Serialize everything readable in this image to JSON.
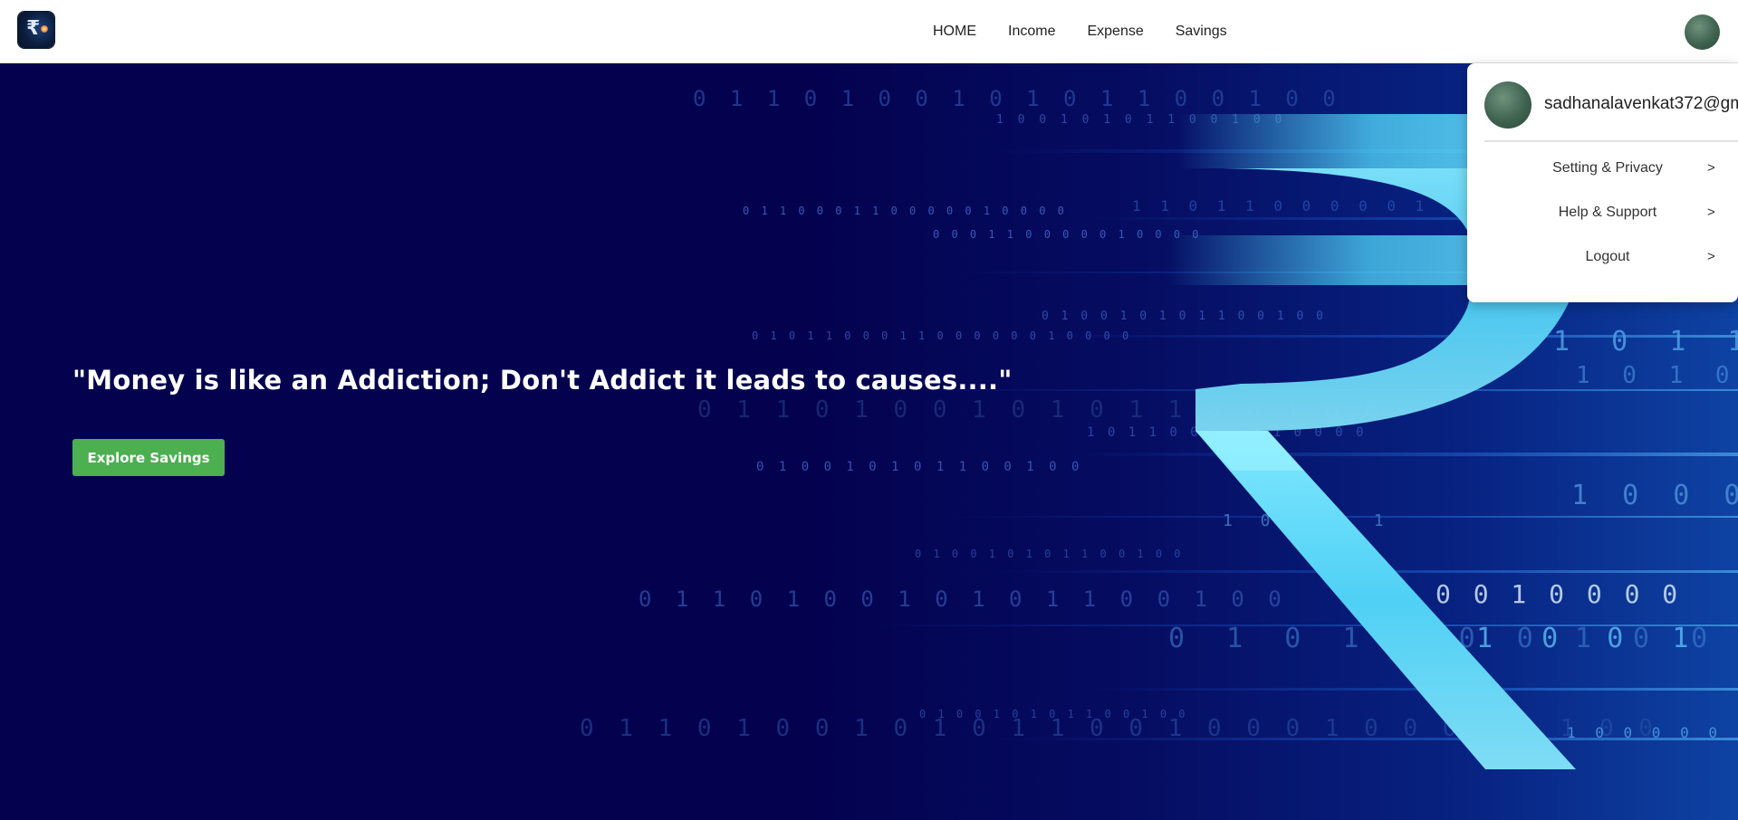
{
  "navbar": {
    "logo_icon": "rupee-logo-icon",
    "links": [
      {
        "label": "HOME"
      },
      {
        "label": "Income"
      },
      {
        "label": "Expense"
      },
      {
        "label": "Savings"
      }
    ],
    "avatar_icon": "user-avatar"
  },
  "hero": {
    "quote": "\"Money is like an Addiction; Don't Addict it leads to causes....\"",
    "cta_label": "Explore Savings",
    "cta_color": "#4caf50",
    "background_color": "#04024f",
    "binary_rows": [
      "0 1 1 0 1 0 0 1 0 1 0 1 1 0 0 1 0 0",
      "1 0 0 1 0 1 0 1 1 0 0 1 0 0",
      "0 1 1 0 0 0 1 1 0 0 0 0 0 1 0 0 0 0",
      "0 0 0 1 1 0 0 0 0 0 1 0 0 0 0",
      "1 1 0 1 1 0 0 0 0 0 1",
      "0 1 0 1 1 0 0 0 1 1 0 0 0 0 0 0 1 0 0 0 0",
      "0 1 0 0 1 0 1 0 1 1 0 0 1 0 0",
      "1 0 1 1 0 0 0 0 0 1 0 0 0 0",
      "0 1 1 0 1 0 0 1 0 1 0 1 1 0 0 1 0 0",
      "1 0 1 1",
      "1 0 1 0 0",
      "0 1 0 0 1 0 1 0 1 1 0 0 1 0 0",
      "1 0 0 0 0 0",
      "1 0 1 0 1",
      "0 1 0 0 1 0 1 0 1 1 0 0 1 0 0",
      "0 1 1 0 1 0 0 1 0 1 0 1 1 0 0 1 0 0",
      "0 0 1 0 0 0 0",
      "0 1 0 1 1 0 0 1 0 0",
      "1 0 0 1 0 0",
      "0 1 0 0 1 0 1 0 1 1 0 0 1 0 0",
      "0 1 1 0 1 0 0 1 0 1 0 1 1 0 0 1 0 0 0 1 0 0 0 0 0 1 0 0",
      "1 0 0 0 0 0"
    ]
  },
  "dropdown": {
    "email": "sadhanalavenkat372@gm",
    "items": [
      {
        "label": "Setting & Privacy",
        "arrow": ">"
      },
      {
        "label": "Help & Support",
        "arrow": ">"
      },
      {
        "label": "Logout",
        "arrow": ">"
      }
    ]
  }
}
